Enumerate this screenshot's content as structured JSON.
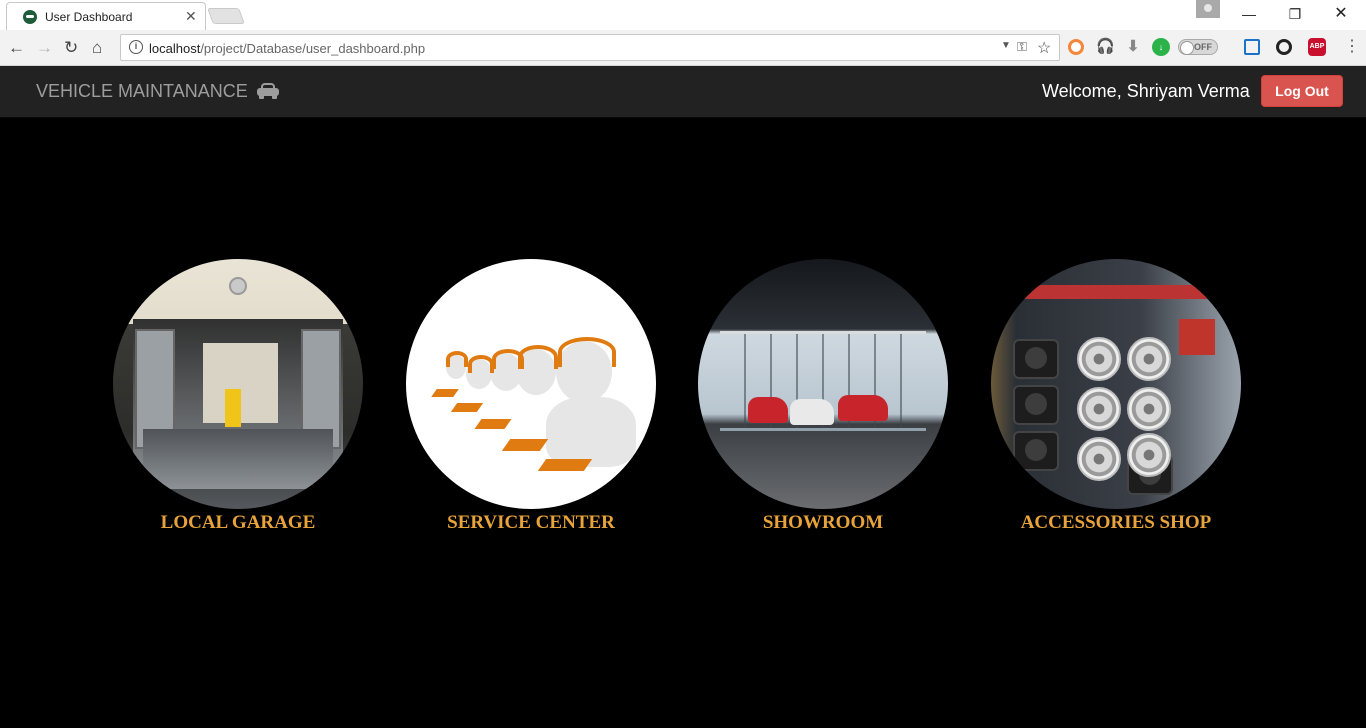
{
  "browser": {
    "tab_title": "User Dashboard",
    "url_host": "localhost",
    "url_path": "/project/Database/user_dashboard.php",
    "ext_off_label": "OFF",
    "abp_label": "ABP"
  },
  "navbar": {
    "brand": "VEHICLE MAINTANANCE",
    "welcome": "Welcome, Shriyam Verma",
    "logout": "Log Out"
  },
  "tiles": [
    {
      "label": "LOCAL GARAGE"
    },
    {
      "label": "SERVICE CENTER"
    },
    {
      "label": "SHOWROOM"
    },
    {
      "label": "ACCESSORIES SHOP"
    }
  ],
  "colors": {
    "navbar_bg": "#222222",
    "logout_bg": "#d9534f",
    "tile_label": "#e8a33a",
    "page_bg": "#000000"
  }
}
